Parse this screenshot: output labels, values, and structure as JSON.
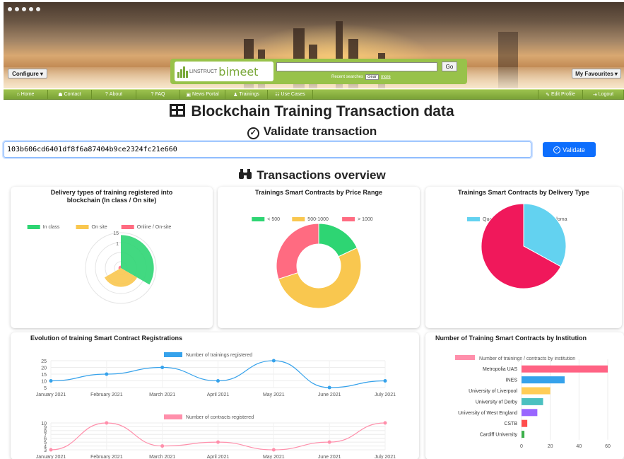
{
  "header": {
    "configure_label": "Configure",
    "favourites_label": "My Favourites",
    "logo_prefix": "LINSTRUCT",
    "logo_brand": "bimeet",
    "search": {
      "placeholder": "",
      "go_label": "Go",
      "recent_label": "Recent searches",
      "clear_label": "clear",
      "more_label": "more"
    }
  },
  "nav": {
    "items": [
      {
        "icon": "⌂",
        "label": "Home"
      },
      {
        "icon": "☗",
        "label": "Contact"
      },
      {
        "icon": "?",
        "label": "About"
      },
      {
        "icon": "?",
        "label": "FAQ"
      },
      {
        "icon": "▣",
        "label": "News Portal"
      },
      {
        "icon": "♟",
        "label": "Trainings"
      },
      {
        "icon": "☷",
        "label": "Use Cases"
      }
    ],
    "right_items": [
      {
        "icon": "✎",
        "label": "Edit Profile"
      },
      {
        "icon": "⇥",
        "label": "Logout"
      }
    ]
  },
  "page": {
    "title": "Blockchain Training Transaction data",
    "validate_title": "Validate transaction",
    "tx_value": "103b606cd6401df8f6a87404b9ce2324fc21e660",
    "validate_button": "Validate",
    "overview_title": "Transactions overview",
    "overview_icon": "binoculars-icon"
  },
  "colors": {
    "green": "#2ed573",
    "yellow": "#f9c74f",
    "red": "#ff6b81",
    "cyan": "#63d2f0",
    "crimson": "#f0185b",
    "blue": "#36a2eb",
    "pink": "#ff8fab",
    "accent_nav": "#8ab640"
  },
  "chart_data": [
    {
      "type": "polar-area",
      "title": "Delivery types of training registered into blockchain (In class / On site)",
      "legend": [
        "In class",
        "On site",
        "Online / On-site"
      ],
      "values": [
        14,
        8,
        1
      ],
      "r_ticks": [
        "15",
        "1"
      ],
      "r_max": 15
    },
    {
      "type": "doughnut",
      "title": "Trainings Smart Contracts by Price Range",
      "legend": [
        "< 500",
        "500-1000",
        "> 1000"
      ],
      "values": [
        18,
        52,
        30
      ]
    },
    {
      "type": "pie",
      "title": "Trainings Smart Contracts by Delivery Type",
      "legend": [
        "Qualification",
        "Diploma"
      ],
      "values": [
        33,
        67
      ]
    },
    {
      "type": "line",
      "title": "Evolution of training Smart Contract Registrations",
      "x": [
        "January 2021",
        "February 2021",
        "March 2021",
        "April 2021",
        "May 2021",
        "June 2021",
        "July 2021"
      ],
      "series": [
        {
          "name": "Number of trainings registered",
          "values": [
            10,
            15,
            20,
            10,
            25,
            5,
            10
          ],
          "yticks": [
            "25",
            "20",
            "15",
            "10",
            "5"
          ],
          "ylim": [
            5,
            25
          ]
        },
        {
          "name": "Number of contracts registered",
          "values": [
            3,
            10,
            4,
            5,
            3,
            5,
            10
          ],
          "yticks": [
            "10",
            "9",
            "8",
            "7",
            "6",
            "5",
            "4",
            "3"
          ],
          "ylim": [
            3,
            10
          ]
        }
      ]
    },
    {
      "type": "bar",
      "orientation": "horizontal",
      "title": "Number of Training Smart Contracts by Institution",
      "legend": [
        "Number of trainings / contracts by institution"
      ],
      "categories": [
        "Metropolia UAS",
        "INES",
        "University of Liverpool",
        "University of Derby",
        "University of West England",
        "CSTB",
        "Cardiff University"
      ],
      "values": [
        60,
        30,
        20,
        15,
        11,
        4,
        2
      ],
      "xticks": [
        "0",
        "20",
        "40",
        "60"
      ],
      "xlim": [
        0,
        60
      ]
    }
  ]
}
